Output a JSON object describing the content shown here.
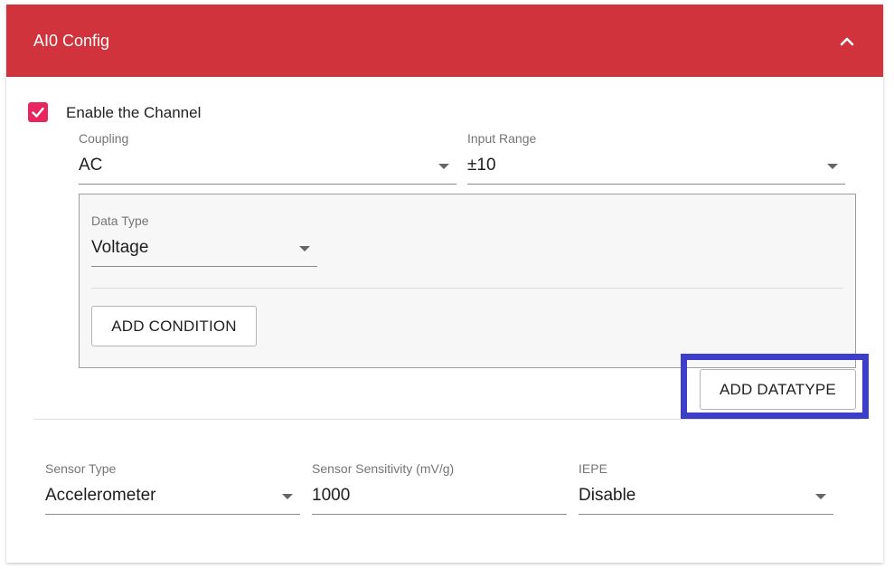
{
  "header": {
    "title": "AI0 Config",
    "toggle_icon": "chevron-up-icon"
  },
  "channel": {
    "enable_label": "Enable the Channel",
    "enabled": true
  },
  "coupling": {
    "label": "Coupling",
    "value": "AC"
  },
  "input_range": {
    "label": "Input Range",
    "value": "±10"
  },
  "data_type": {
    "label": "Data Type",
    "value": "Voltage"
  },
  "buttons": {
    "add_condition": "ADD CONDITION",
    "add_datatype": "ADD DATATYPE"
  },
  "sensor_type": {
    "label": "Sensor Type",
    "value": "Accelerometer"
  },
  "sensor_sensitivity": {
    "label": "Sensor Sensitivity (mV/g)",
    "value": "1000"
  },
  "iepe": {
    "label": "IEPE",
    "value": "Disable"
  },
  "colors": {
    "header_bg": "#d1333c",
    "checkbox": "#e8255f",
    "highlight": "#3d3fcb"
  }
}
